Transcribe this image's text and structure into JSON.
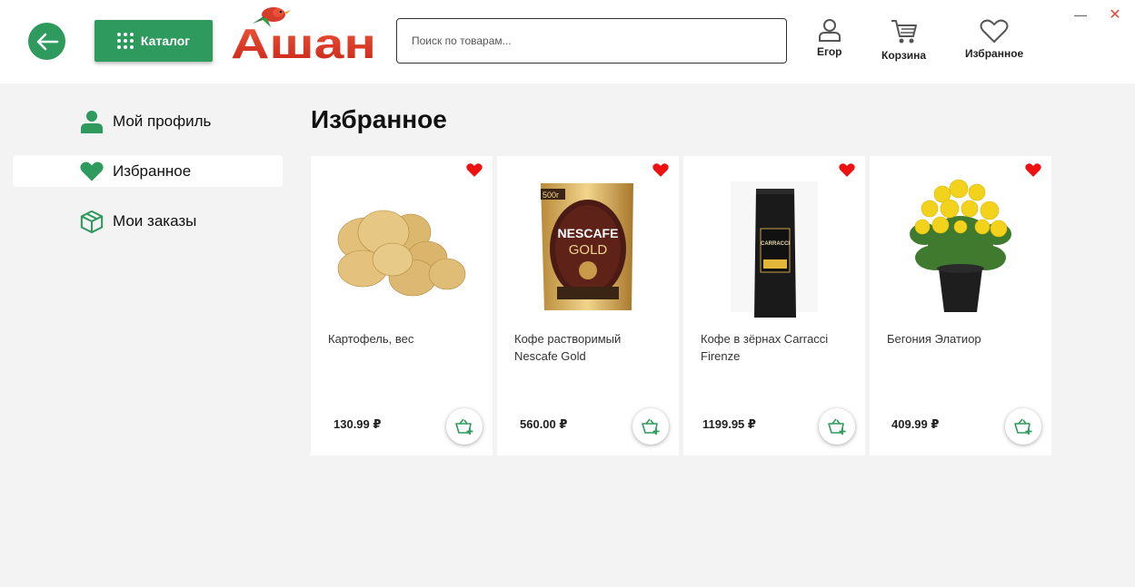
{
  "header": {
    "catalog_label": "Каталог",
    "logo_text": "Ашан",
    "search_placeholder": "Поиск по товарам...",
    "profile_label": "Егор",
    "cart_label": "Корзина",
    "favorites_label": "Избранное",
    "accent_color": "#2e9a5e",
    "brand_color": "#e43d2b"
  },
  "window": {
    "minimize": "—",
    "close": "✕"
  },
  "sidebar": {
    "items": [
      {
        "label": "Мой профиль",
        "icon": "user-icon",
        "active": false
      },
      {
        "label": "Избранное",
        "icon": "heart-icon",
        "active": true
      },
      {
        "label": "Мои заказы",
        "icon": "box-icon",
        "active": false
      }
    ]
  },
  "main": {
    "title": "Избранное",
    "products": [
      {
        "name": "Картофель, вес",
        "price": "130.99 ₽",
        "image": "potatoes"
      },
      {
        "name": "Кофе растворимый Nescafe Gold",
        "price": "560.00 ₽",
        "image": "nescafe-gold-bag",
        "bag_weight": "500г",
        "bag_brand": "NESCAFE",
        "bag_sub": "GOLD"
      },
      {
        "name": "Кофе в зёрнах Carracci Firenze",
        "price": "1199.95 ₽",
        "image": "carracci-coffee-bag",
        "bag_brand": "CARRACCI"
      },
      {
        "name": "Бегония Элатиор",
        "price": "409.99 ₽",
        "image": "begonia-plant"
      }
    ]
  }
}
